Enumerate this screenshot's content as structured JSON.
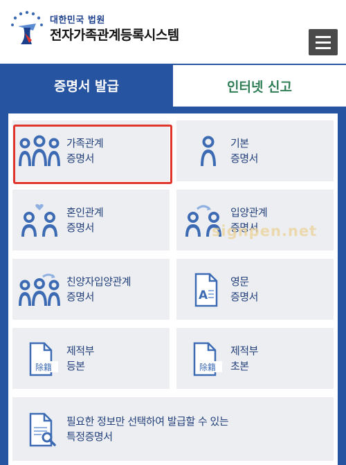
{
  "header": {
    "court_name": "대한민국 법원",
    "system_name": "전자가족관계등록시스템",
    "logo_icon": "court-logo-icon",
    "menu_icon": "hamburger-menu-icon"
  },
  "tabs": [
    {
      "label": "증명서 발급",
      "active": true
    },
    {
      "label": "인터넷 신고",
      "active": false
    }
  ],
  "cards": [
    {
      "line1": "가족관계",
      "line2": "증명서",
      "icon": "family-people-icon"
    },
    {
      "line1": "기본",
      "line2": "증명서",
      "icon": "single-person-icon"
    },
    {
      "line1": "혼인관계",
      "line2": "증명서",
      "icon": "marriage-couple-icon"
    },
    {
      "line1": "입양관계",
      "line2": "증명서",
      "icon": "adoption-couple-icon"
    },
    {
      "line1": "친양자입양관계",
      "line2": "증명서",
      "icon": "full-adoption-family-icon"
    },
    {
      "line1": "영문",
      "line2": "증명서",
      "icon": "english-document-icon"
    },
    {
      "line1": "제적부",
      "line2": "등본",
      "icon": "register-document-icon",
      "doc_text": "除籍"
    },
    {
      "line1": "제적부",
      "line2": "초본",
      "icon": "register-document-icon",
      "doc_text": "除籍"
    },
    {
      "line1": "필요한 정보만 선택하여 발급할 수 있는",
      "line2": "특정증명서",
      "icon": "document-search-icon"
    }
  ],
  "watermark": "signpen.net",
  "colors": {
    "primary_blue": "#2754a0",
    "inactive_tab_text": "#2e7d55",
    "card_bg": "#eceef1",
    "icon_blue": "#3c6ab3",
    "highlight_red": "#e0352b"
  }
}
